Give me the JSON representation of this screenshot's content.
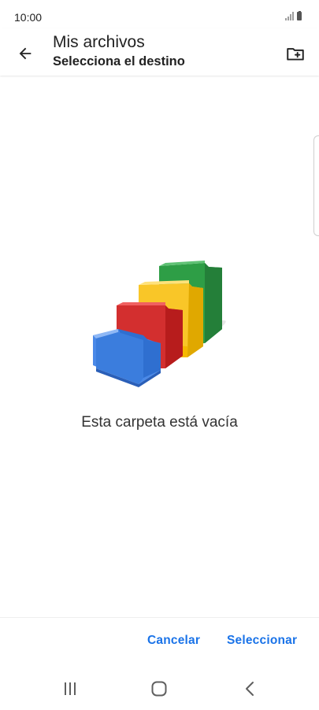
{
  "status_bar": {
    "time": "10:00",
    "icons": [
      "signal-icon",
      "battery-icon"
    ]
  },
  "app_bar": {
    "title": "Mis archivos",
    "subtitle": "Selecciona el destino",
    "icons": [
      "arrow-left-icon",
      "new-folder-icon"
    ]
  },
  "empty_state": {
    "message": "Esta carpeta está vacía",
    "illustration": "empty-folders-illustration",
    "colors": {
      "blue": "#3b7ddd",
      "red": "#d32f2f",
      "yellow": "#fbc02d",
      "green": "#2e9e46"
    }
  },
  "actions": {
    "cancel_label": "Cancelar",
    "select_label": "Seleccionar",
    "accent_color": "#1a73e8"
  },
  "nav_bar": {
    "icons": [
      "recents-icon",
      "home-icon",
      "back-icon"
    ]
  }
}
